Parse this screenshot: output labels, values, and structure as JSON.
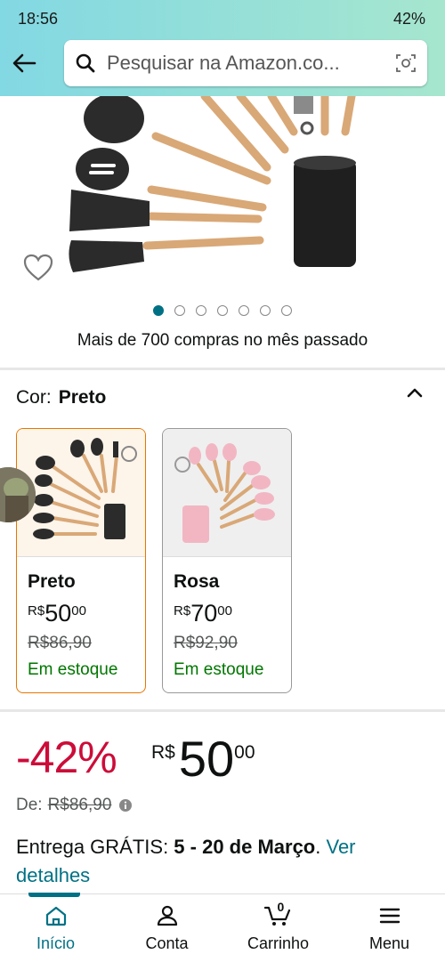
{
  "status_bar": {
    "time": "18:56",
    "battery": "42%"
  },
  "search": {
    "placeholder": "Pesquisar na Amazon.co..."
  },
  "gallery": {
    "image_count": 7,
    "active_index": 0
  },
  "purchases_text": "Mais de 700 compras no mês passado",
  "color": {
    "label": "Cor:",
    "selected": "Preto"
  },
  "swatches": [
    {
      "name": "Preto",
      "currency": "R$",
      "whole": "50",
      "fraction": "00",
      "old_price": "R$86,90",
      "stock": "Em estoque"
    },
    {
      "name": "Rosa",
      "currency": "R$",
      "whole": "70",
      "fraction": "00",
      "old_price": "R$92,90",
      "stock": "Em estoque"
    }
  ],
  "price": {
    "discount": "-42%",
    "currency": "R$",
    "whole": "50",
    "fraction": "00",
    "de_label": "De:",
    "old_price": "R$86,90"
  },
  "delivery": {
    "prefix": "Entrega GRÁTIS: ",
    "dates": "5 - 20 de Março",
    "sep": ". ",
    "link": "Ver detalhes"
  },
  "nav": {
    "home": "Início",
    "account": "Conta",
    "cart": "Carrinho",
    "cart_count": "0",
    "menu": "Menu"
  },
  "colors": {
    "accent": "#007185",
    "deal_red": "#cc0c39",
    "stock_green": "#007600",
    "selected_border": "#e77600"
  }
}
